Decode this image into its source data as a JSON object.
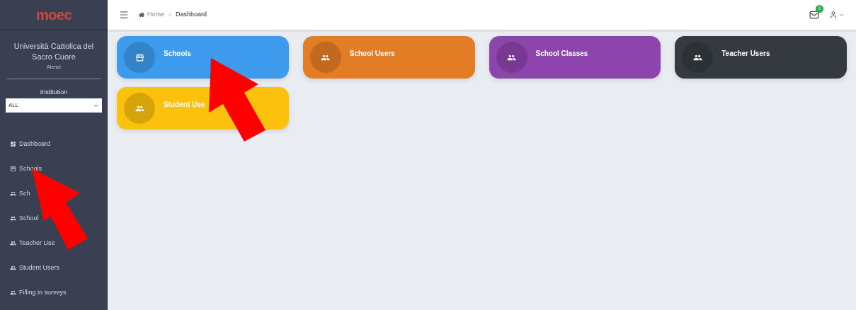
{
  "logo": "moec",
  "sidebar": {
    "institution_name": "Università Cattolica del Sacro Cuore",
    "institution_type": "Atenei",
    "filter": {
      "label": "Institution",
      "value": "ALL"
    },
    "items": [
      {
        "label": "Dashboard",
        "kind": "dashboard"
      },
      {
        "label": "Schools",
        "kind": "store"
      },
      {
        "label": "Sch",
        "kind": "people"
      },
      {
        "label": "School",
        "kind": "people"
      },
      {
        "label": "Teacher Use",
        "kind": "people"
      },
      {
        "label": "Student Users",
        "kind": "people"
      },
      {
        "label": "Filling in surveys",
        "kind": "people"
      }
    ]
  },
  "topbar": {
    "breadcrumb": [
      "Home",
      "Dashboard"
    ],
    "notification_count": "0"
  },
  "cards": [
    {
      "title": "Schools",
      "kind": "store",
      "color": "#3d9aed"
    },
    {
      "title": "School Users",
      "kind": "people",
      "color": "#e27c25"
    },
    {
      "title": "School Classes",
      "kind": "people",
      "color": "#8e44ad"
    },
    {
      "title": "Teacher Users",
      "kind": "people",
      "color": "#343a40"
    },
    {
      "title": "Student Use",
      "kind": "people",
      "color": "#fbc10d"
    }
  ]
}
